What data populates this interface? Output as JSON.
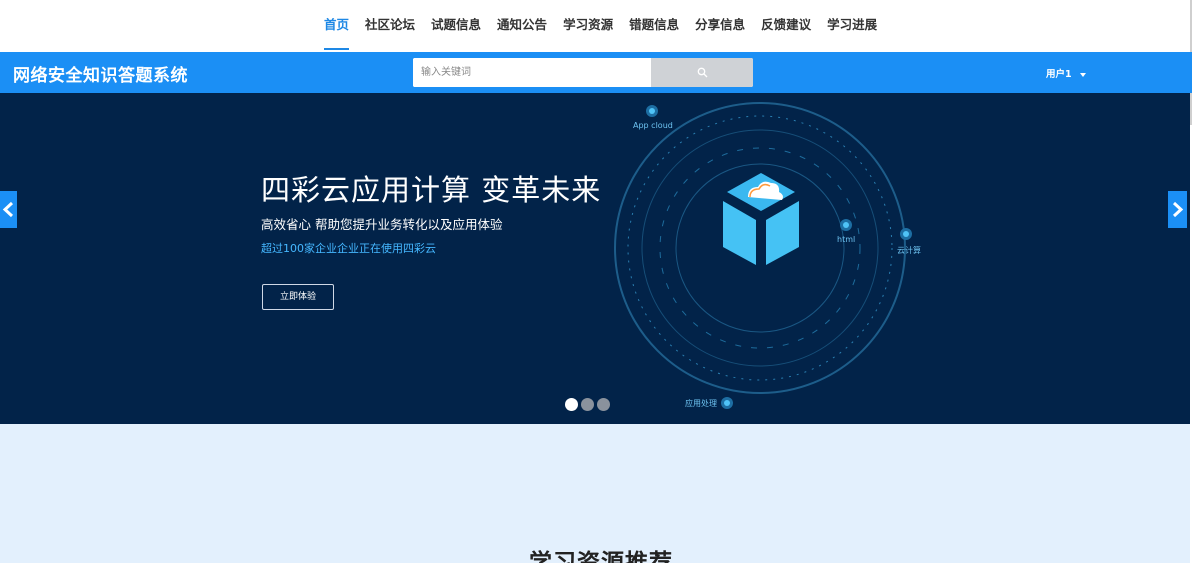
{
  "nav": {
    "items": [
      {
        "label": "首页",
        "active": true
      },
      {
        "label": "社区论坛"
      },
      {
        "label": "试题信息"
      },
      {
        "label": "通知公告"
      },
      {
        "label": "学习资源"
      },
      {
        "label": "错题信息"
      },
      {
        "label": "分享信息"
      },
      {
        "label": "反馈建议"
      },
      {
        "label": "学习进展"
      }
    ]
  },
  "header": {
    "site_title": "网络安全知识答题系统",
    "search_placeholder": "输入关键词",
    "search_icon": "search-icon",
    "user_label": "用户1",
    "brand_color": "#1b8ff5"
  },
  "banner": {
    "title": "四彩云应用计算 变革未来",
    "subtitle": "高效省心 帮助您提升业务转化以及应用体验",
    "highlight": "超过100家企业企业正在使用四彩云",
    "button_label": "立即体验",
    "background_color": "#022349",
    "slide_count": 3,
    "active_slide": 1,
    "graphic_labels": {
      "app_cloud": "App cloud",
      "html": "html",
      "cloud_compute": "云计算",
      "app_processing": "应用处理"
    }
  },
  "section": {
    "title": "学习资源推荐"
  }
}
